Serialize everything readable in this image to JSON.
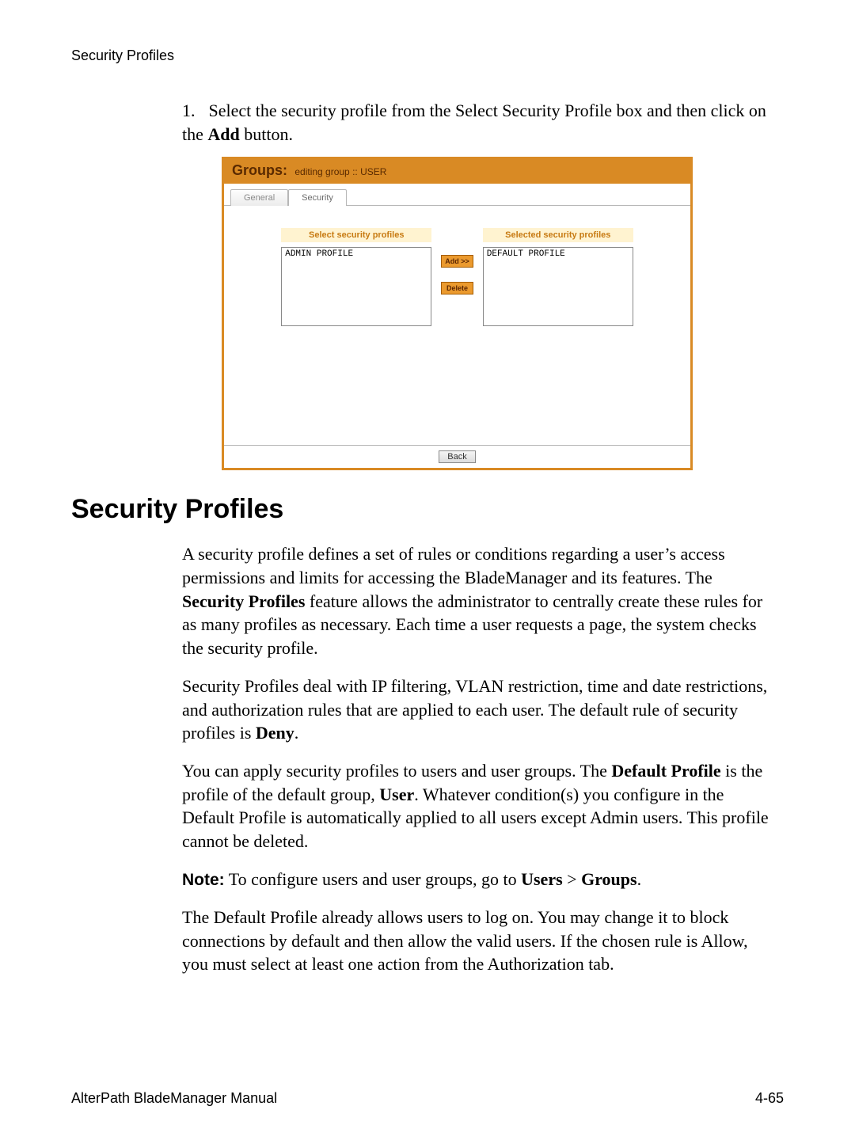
{
  "running_head": "Security Profiles",
  "step": {
    "number": "1.",
    "pre": "Select the security profile from the Select Security Profile box and then click on the ",
    "bold": "Add",
    "post": " button."
  },
  "screenshot": {
    "header_label": "Groups:",
    "header_sub": "editing group  ::  USER",
    "tabs": {
      "general": "General",
      "security": "Security"
    },
    "left_title": "Select security profiles",
    "right_title": "Selected security profiles",
    "left_item": "ADMIN PROFILE",
    "right_item": "DEFAULT PROFILE",
    "add_btn": "Add >>",
    "delete_btn": "Delete",
    "back_btn": "Back"
  },
  "section_heading": "Security Profiles",
  "p1": {
    "a": "A security profile defines a set of rules or conditions regarding a user’s access permissions and limits for accessing the BladeManager and its features. The ",
    "b": "Security Profiles",
    "c": " feature allows the administrator to centrally create these rules for as many profiles as necessary. Each time a user requests a page, the system checks the security profile."
  },
  "p2": {
    "a": "Security Profiles deal with IP filtering, VLAN restriction, time and date restrictions, and authorization rules that are applied to each user. The default rule of security profiles is ",
    "b": "Deny",
    "c": "."
  },
  "p3": {
    "a": "You can apply security profiles to users and user groups. The ",
    "b": "Default Profile",
    "c": " is the profile of the default group, ",
    "d": "User",
    "e": ". Whatever condition(s) you configure in the Default Profile is automatically applied to all users except Admin users. This profile cannot be deleted."
  },
  "p4": {
    "a": "Note:",
    "b": " To configure users and user groups, go to ",
    "c": "Users",
    "d": " > ",
    "e": "Groups",
    "f": "."
  },
  "p5": "The Default Profile already allows users to log on. You may change it to block connections by default and then allow the valid users. If the chosen rule is Allow, you must select at least one action from the Authorization tab.",
  "footer": {
    "left": "AlterPath BladeManager Manual",
    "right": "4-65"
  }
}
